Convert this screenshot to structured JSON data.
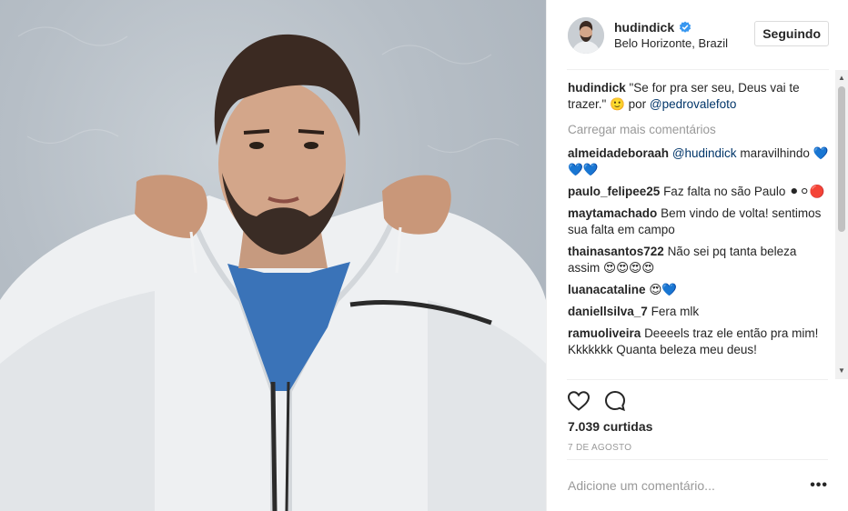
{
  "post": {
    "username": "hudindick",
    "location": "Belo Horizonte, Brazil",
    "follow_button": "Seguindo",
    "caption": {
      "author": "hudindick",
      "text_part1": "\"Se for pra ser seu, Deus vai te trazer.\" 🙂 por ",
      "mention": "@pedrovalefoto"
    },
    "load_more": "Carregar mais comentários",
    "comments": [
      {
        "author": "almeidadeboraah",
        "mention": "@hudindick",
        "text": "maravilhindo 💙💙💙"
      },
      {
        "author": "paulo_felipee25",
        "mention": "",
        "text": "Faz falta no são Paulo ⚫⚪🔴"
      },
      {
        "author": "maytamachado",
        "mention": "",
        "text": "Bem vindo de volta! sentimos sua falta em campo"
      },
      {
        "author": "thainasantos722",
        "mention": "",
        "text": "Não sei pq tanta beleza assim 😍😍😍😍"
      },
      {
        "author": "luanacataline",
        "mention": "",
        "text": "😍💙"
      },
      {
        "author": "daniellsilva_7",
        "mention": "",
        "text": "Fera mlk"
      },
      {
        "author": "ramuoliveira",
        "mention": "",
        "text": "Deeeels traz ele então pra mim! Kkkkkkk Quanta beleza meu deus!"
      }
    ],
    "likes": "7.039 curtidas",
    "date": "7 DE AGOSTO",
    "add_comment_placeholder": "Adicione um comentário...",
    "more_options": "•••",
    "scroll_up": "▲",
    "scroll_down": "▼"
  },
  "colors": {
    "verified": "#3897f0",
    "mention": "#003569",
    "muted": "#999999",
    "text": "#262626",
    "border": "#efefef"
  },
  "icons": [
    "verified-badge-icon",
    "heart-icon",
    "comment-bubble-icon",
    "more-options-icon"
  ]
}
